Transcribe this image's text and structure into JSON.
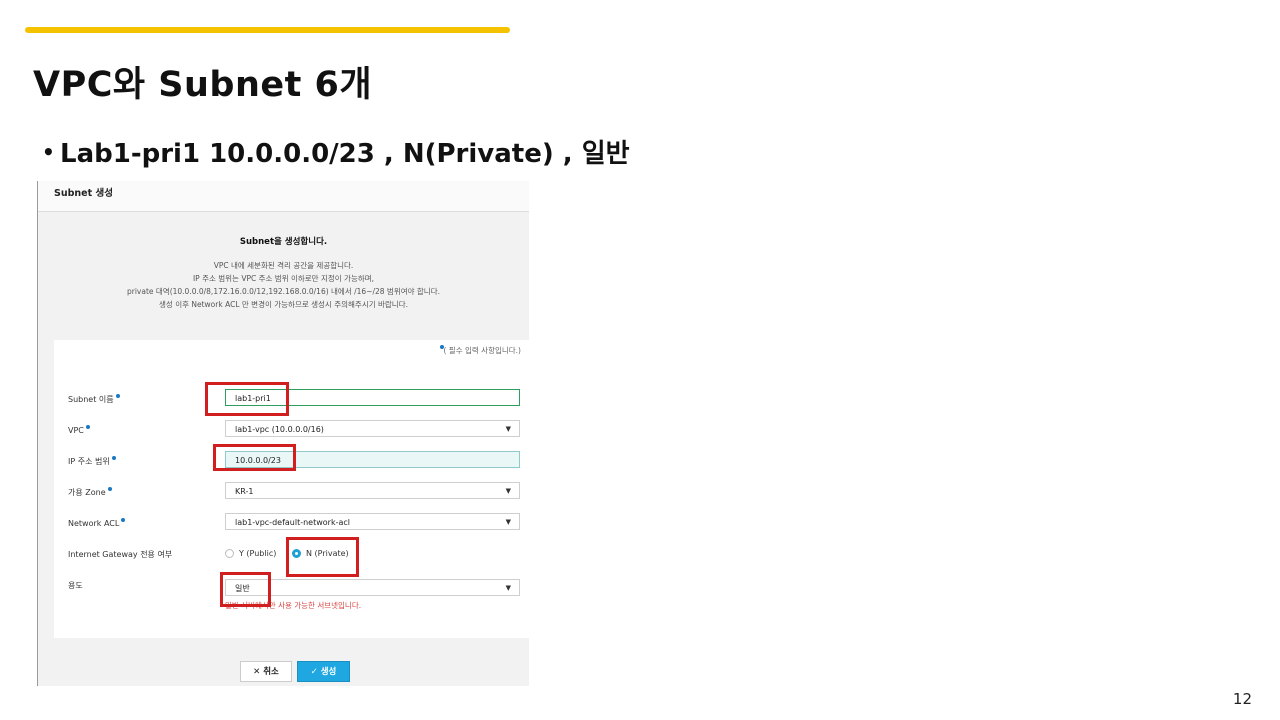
{
  "slide": {
    "title": "VPC와 Subnet 6개",
    "bullet_mark": "•",
    "bullet": "Lab1-pri1 10.0.0.0/23  , N(Private) , 일반",
    "page_number": "12",
    "accent_color": "#f5c200"
  },
  "dialog": {
    "title": "Subnet 생성",
    "intro": {
      "heading": "Subnet을 생성합니다.",
      "lines": [
        "VPC 내에 세분화된 격리 공간을 제공합니다.",
        "IP 주소 범위는 VPC 주소 범위 이하로만 지정이 가능하며,",
        "private 대역(10.0.0.0/8,172.16.0.0/12,192.168.0.0/16) 내에서 /16~/28 범위여야 합니다.",
        "생성 이후 Network ACL 만 변경이 가능하므로 생성시 주의해주시기 바랍니다."
      ]
    },
    "required_note": "( 필수 입력 사항입니다.)",
    "fields": {
      "subnet_name": {
        "label": "Subnet 이름",
        "value": "lab1-pri1"
      },
      "vpc": {
        "label": "VPC",
        "value": "lab1-vpc (10.0.0.0/16)"
      },
      "ip_range": {
        "label": "IP 주소 범위",
        "value": "10.0.0.0/23"
      },
      "zone": {
        "label": "가용 Zone",
        "value": "KR-1"
      },
      "network_acl": {
        "label": "Network ACL",
        "value": "lab1-vpc-default-network-acl"
      },
      "igw": {
        "label": "Internet Gateway 전용 여부",
        "option_public": "Y (Public)",
        "option_private": "N (Private)",
        "selected": "N (Private)"
      },
      "usage": {
        "label": "용도",
        "value": "일반",
        "hint": "일반 서버에서만 사용 가능한 서브넷입니다."
      }
    },
    "buttons": {
      "cancel": "✕ 취소",
      "create": "✓ 생성"
    },
    "caret": "▼",
    "highlight_color": "#d11e1e",
    "primary_color": "#1ea7e1"
  }
}
